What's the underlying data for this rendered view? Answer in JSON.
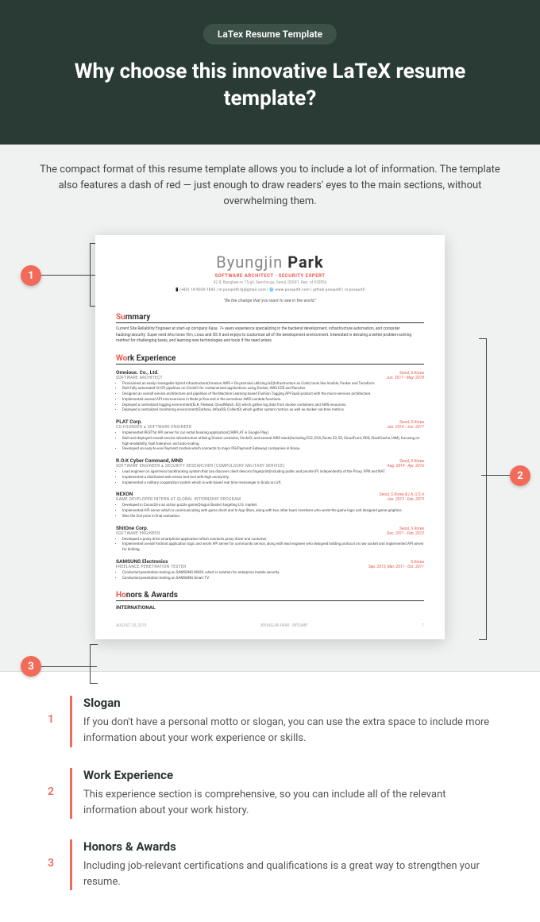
{
  "hero": {
    "badge": "LaTex Resume Template",
    "title": "Why choose this innovative LaTeX resume template?"
  },
  "intro": "The compact format of this resume template allows you to include a lot of information. The template also features a dash of red — just enough to draw readers' eyes to the main sections, without overwhelming them.",
  "resume": {
    "name_first": "Byungjin ",
    "name_last": "Park",
    "subtitle": "SOFTWARE ARCHITECT · SECURITY EXPERT",
    "address": "42-8, Bangbae-ro 15-gil, Seocho-gu, Seoul, 00681, Rep. of KOREA",
    "contacts": "📱(+82) 10-9030-1843  |  ✉ posquit0.bj@gmail.com  |  🌐 www.posquit0.com  |  github posquit0  |  in posquit0",
    "motto": "\"Be the change that you want to see in the world.\"",
    "summary_title_red": "Su",
    "summary_title_rest": "mmary",
    "summary_text": "Current Site Reliability Engineer at start-up company Kasa. 7+ years experience specializing in the backend development, infrastructure automation, and computer hacking/security. Super nerd who loves Vim, Linux and OS X and enjoys to customize all of the development environment. Interested in devising a better problem-solving method for challenging tasks, and learning new technologies and tools if the need arises.",
    "work_title_red": "Wo",
    "work_title_rest": "rk Experience",
    "jobs": [
      {
        "company": "Omnious. Co., Ltd.",
        "loc": "Seoul, S.Korea",
        "role": "SOFTWARE ARCHITECT",
        "date": "Jun. 2017 - May. 2018",
        "bullets": [
          "Provisioned an easily managable hybrid infrastructure(Amazon AWS + On-premise) utilizing IaC(Infrastructure as Code) tools like Ansible, Packer and Terraform.",
          "Built fully automated CI/CD pipelines on CircleCI for containerized applications using Docker, AWS ECR and Rancher.",
          "Designed an overall service architecture and pipelines of the Machine Learning based Fashion Tagging API SaaS product with the micro-services architecture.",
          "Implemented several API microservices in Node.js Koa and in the serverless AWS Lambda functions.",
          "Deployed a centralized logging environment(ELK, Filebeat, CloudWatch, S3) which gather log data from docker containers and AWS resources.",
          "Deployed a centralized monitoring environment(Grafana, InfluxDB, CollectD) which gather system metrics as well as docker run-time metrics."
        ]
      },
      {
        "company": "PLAT Corp.",
        "loc": "Seoul, S.Korea",
        "role": "CO-FOUNDER & SOFTWARE ENGINEER",
        "date": "Jan. 2016 - Jun. 2017",
        "bullets": [
          "Implemented RESTful API server for car rental booking application(CARPLAT in Google Play).",
          "Built and deployed overall service infrastructure utilizing Docker container, CircleCI, and several AWS stack(Including EC2, ECS, Route 53, S3, CloudFront, RDS, ElastiCache, IAM), focusing on high-availability, fault tolerance, and auto-scaling.",
          "Developed an easy-to-use Payment module which connects to major PG(Payment Gateway) companies in Korea."
        ]
      },
      {
        "company": "R.O.K Cyber Command, MND",
        "loc": "Seoul, S.Korea",
        "role": "SOFTWARE ENGINEER & SECURITY RESEARCHER (COMPULSORY MILITARY SERVICE)",
        "date": "Aug. 2014 - Apr. 2016",
        "bullets": [
          "Lead engineer on agent-less backtracking system that can discover client device's fingerprint(including public and private IP) independently of the Proxy, VPN and NAT.",
          "Implemented a distributed web stress test tool with high anonymity.",
          "Implemented a military cooperation system which is web based real time messenger in Scala on Lift."
        ]
      },
      {
        "company": "NEXON",
        "loc": "Seoul, S.Korea & LA, U.S.A",
        "role": "GAME DEVELOPER INTERN AT GLOBAL INTERNSHIP PROGRAM",
        "date": "Jan. 2013 - Feb. 2013",
        "bullets": [
          "Developed in Cocos2d-x an action puzzle game(Dragon Buster) targeting U.S. market.",
          "Implemented API server which is communicating with game client and In-App Store, along with two other team members who wrote the game logic and designed game graphics.",
          "Won the 2nd prize in final evaluation."
        ]
      },
      {
        "company": "ShitOne Corp.",
        "loc": "Seoul, S.Korea",
        "role": "SOFTWARE ENGINEER",
        "date": "Dec. 2011 - Feb. 2012",
        "bullets": [
          "Developed a proxy drive smartphone application which connects proxy driver and customer.",
          "Implemented overall Android application logic and wrote API server for community service, along with lead engineer who designed bidding protocol on raw socket and implemented API server for bidding."
        ]
      },
      {
        "company": "SAMSUNG Electronics",
        "loc": "S.Korea",
        "role": "FREELANCE PENETRATION TESTER",
        "date": "Sep. 2013, Mar. 2011 - Oct. 2011",
        "bullets": [
          "Conducted penetration testing on SAMSUNG KNOX, which is solution for enterprise mobile security.",
          "Conducted penetration testing on SAMSUNG Smart TV."
        ]
      }
    ],
    "honors_title_red": "Ho",
    "honors_title_rest": "nors & Awards",
    "honors_sub": "INTERNATIONAL",
    "footer_left": "AUGUST 25, 2019",
    "footer_center": "BYUNGJIN PARK · RÉSUMÉ",
    "footer_right": "1"
  },
  "pointers": {
    "p1": "1",
    "p2": "2",
    "p3": "3"
  },
  "legend": [
    {
      "num": "1",
      "title": "Slogan",
      "text": "If you don't have a personal motto or slogan, you can use the extra space to include more information about your work experience or skills."
    },
    {
      "num": "2",
      "title": "Work Experience",
      "text": "This experience section is comprehensive, so you can include all of the relevant information about your work history."
    },
    {
      "num": "3",
      "title": "Honors & Awards",
      "text": "Including job-relevant certifications and qualifications is a great way to strengthen your resume."
    }
  ]
}
